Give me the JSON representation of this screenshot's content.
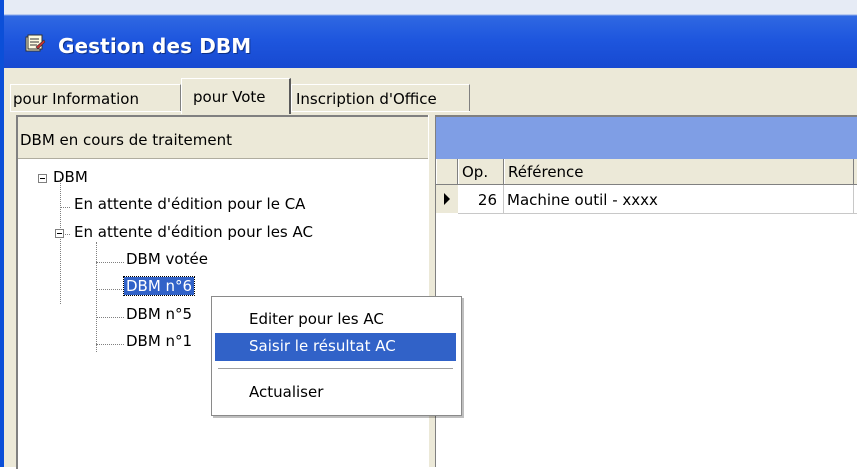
{
  "window": {
    "title": "Gestion des DBM"
  },
  "tabs": [
    {
      "label": "pour Information"
    },
    {
      "label": "pour Vote"
    },
    {
      "label": "Inscription d'Office"
    }
  ],
  "left_pane": {
    "header": "DBM en cours de traitement"
  },
  "tree": {
    "root": "DBM",
    "n1": "En attente d'édition pour le CA",
    "n2": "En attente d'édition pour les AC",
    "n2_children": [
      "DBM votée",
      "DBM n°6",
      "DBM n°5",
      "DBM n°1"
    ]
  },
  "grid": {
    "columns": [
      "Op.",
      "Référence"
    ],
    "rows": [
      {
        "op": "26",
        "reference": "Machine outil  - xxxx"
      }
    ]
  },
  "context_menu": {
    "items": [
      "Editer pour les AC",
      "Saisir le résultat AC",
      "Actualiser"
    ],
    "highlighted": "Saisir le résultat AC"
  },
  "colors": {
    "title_bar": "#1e56de",
    "selection": "#3162c8",
    "right_header": "#7f9ee5"
  }
}
